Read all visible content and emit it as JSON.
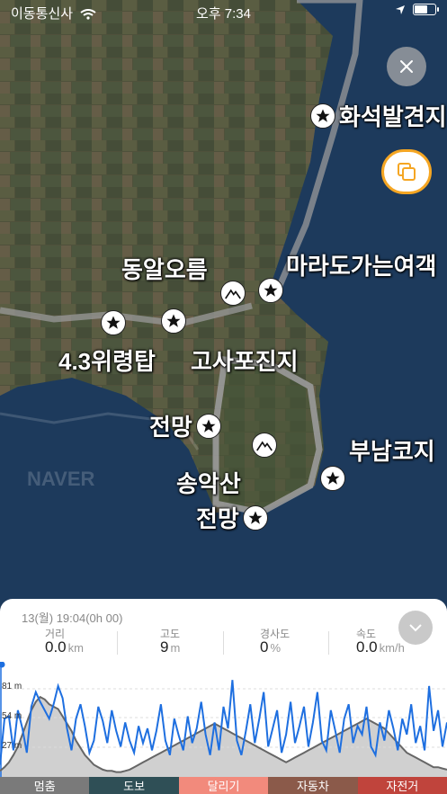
{
  "status": {
    "carrier": "이동통신사",
    "time": "오후 7:34"
  },
  "map": {
    "places": [
      {
        "name": "화석발견지",
        "kind": "star"
      },
      {
        "name": "마라도가는여객",
        "kind": "star"
      },
      {
        "name": "동알오름",
        "kind": "mountain"
      },
      {
        "name": "4.3위령탑",
        "kind": "star"
      },
      {
        "name": "고사포진지",
        "kind": "star"
      },
      {
        "name": "전망",
        "kind": "star"
      },
      {
        "name": "송악산",
        "kind": "mountain"
      },
      {
        "name": "부남코지",
        "kind": "star"
      },
      {
        "name": "전망",
        "kind": "star"
      }
    ],
    "watermark": "NAVER"
  },
  "panel": {
    "datetime": "13(월) 19:04(0h 00)",
    "stats": [
      {
        "label": "거리",
        "value": "0.0",
        "unit": "km"
      },
      {
        "label": "고도",
        "value": "9",
        "unit": "m"
      },
      {
        "label": "경사도",
        "value": "0",
        "unit": "%"
      },
      {
        "label": "속도",
        "value": "0.0",
        "unit": "km/h"
      }
    ]
  },
  "chart_data": {
    "type": "line",
    "y_ticks": [
      "81 m",
      "54 m",
      "27 m"
    ],
    "series": [
      {
        "color": "#1e6fe0",
        "values": [
          10,
          48,
          50,
          22,
          55,
          40,
          20,
          58,
          70,
          62,
          55,
          48,
          60,
          75,
          65,
          40,
          22,
          48,
          60,
          42,
          20,
          30,
          58,
          46,
          28,
          55,
          38,
          25,
          45,
          30,
          20,
          42,
          28,
          40,
          22,
          38,
          60,
          30,
          18,
          48,
          34,
          22,
          50,
          28,
          40,
          62,
          35,
          18,
          45,
          22,
          58,
          40,
          80,
          30,
          18,
          38,
          60,
          28,
          48,
          70,
          25,
          40,
          55,
          20,
          35,
          62,
          28,
          42,
          58,
          25,
          45,
          70,
          30,
          22,
          55,
          38,
          20,
          48,
          60,
          28,
          42,
          35,
          58,
          25,
          18,
          45,
          30,
          55,
          40,
          22,
          48,
          35,
          60,
          28,
          42,
          22,
          75,
          38,
          55,
          25,
          45
        ]
      },
      {
        "color": "#666666",
        "values": [
          5,
          8,
          12,
          18,
          25,
          35,
          45,
          55,
          62,
          66,
          64,
          60,
          58,
          56,
          50,
          44,
          38,
          30,
          24,
          18,
          14,
          10,
          8,
          6,
          5,
          5,
          4,
          4,
          5,
          6,
          8,
          10,
          12,
          14,
          16,
          18,
          20,
          22,
          24,
          26,
          28,
          30,
          32,
          34,
          36,
          38,
          40,
          42,
          44,
          42,
          40,
          38,
          36,
          34,
          32,
          30,
          28,
          26,
          24,
          22,
          20,
          18,
          16,
          14,
          12,
          14,
          16,
          18,
          20,
          22,
          24,
          26,
          28,
          30,
          32,
          34,
          36,
          38,
          40,
          42,
          44,
          46,
          48,
          46,
          44,
          42,
          40,
          36,
          32,
          28,
          24,
          20,
          18,
          16,
          14,
          12,
          10,
          8,
          8,
          7,
          6
        ]
      }
    ]
  },
  "modes": [
    {
      "label": "멈춤",
      "color": "#7a7a7a"
    },
    {
      "label": "도보",
      "color": "#2f4f56"
    },
    {
      "label": "달리기",
      "color": "#f28a7c"
    },
    {
      "label": "자동차",
      "color": "#8b5a4a"
    },
    {
      "label": "자전거",
      "color": "#c0443c"
    }
  ]
}
